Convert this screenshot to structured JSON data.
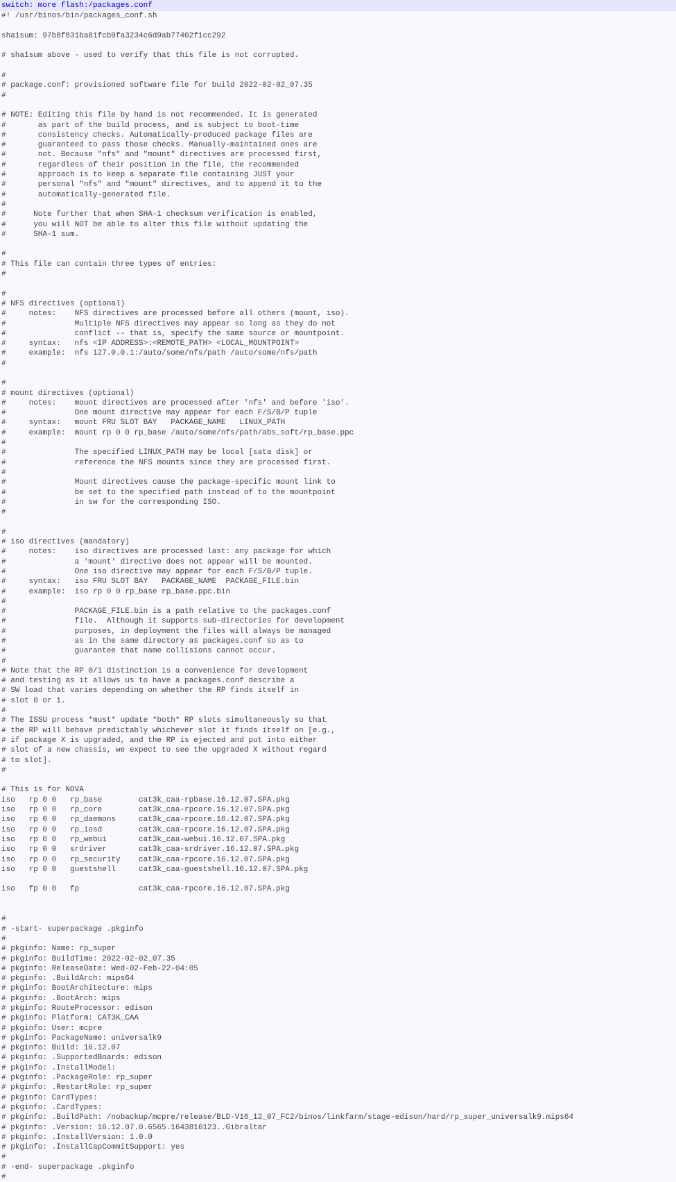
{
  "command": "switch: more flash:/packages.conf",
  "lines": [
    "#! /usr/binos/bin/packages_conf.sh",
    "",
    "sha1sum: 97b8f831ba81fcb9fa3234c6d9ab77402f1cc292",
    "",
    "# sha1sum above - used to verify that this file is not corrupted.",
    "",
    "#",
    "# package.conf: provisioned software file for build 2022-02-02_07.35",
    "#",
    "",
    "# NOTE: Editing this file by hand is not recommended. It is generated",
    "#       as part of the build process, and is subject to boot-time",
    "#       consistency checks. Automatically-produced package files are",
    "#       guaranteed to pass those checks. Manually-maintained ones are",
    "#       not. Because \"nfs\" and \"mount\" directives are processed first,",
    "#       regardless of their position in the file, the recommended",
    "#       approach is to keep a separate file containing JUST your",
    "#       personal \"nfs\" and \"mount\" directives, and to append it to the",
    "#       automatically-generated file.",
    "#",
    "#      Note further that when SHA-1 checksum verification is enabled,",
    "#      you will NOT be able to alter this file without updating the",
    "#      SHA-1 sum.",
    "",
    "#",
    "# This file can contain three types of entries:",
    "#",
    "",
    "#",
    "# NFS directives (optional)",
    "#     notes:    NFS directives are processed before all others (mount, iso).",
    "#               Multiple NFS directives may appear so long as they do not",
    "#               conflict -- that is, specify the same source or mountpoint.",
    "#     syntax:   nfs <IP ADDRESS>:<REMOTE_PATH> <LOCAL_MOUNTPOINT>",
    "#     example:  nfs 127.0.0.1:/auto/some/nfs/path /auto/some/nfs/path",
    "#",
    "",
    "#",
    "# mount directives (optional)",
    "#     notes:    mount directives are processed after 'nfs' and before 'iso'.",
    "#               One mount directive may appear for each F/S/B/P tuple",
    "#     syntax:   mount FRU SLOT BAY   PACKAGE_NAME   LINUX_PATH",
    "#     example:  mount rp 0 0 rp_base /auto/some/nfs/path/abs_soft/rp_base.ppc",
    "#",
    "#               The specified LINUX_PATH may be local [sata disk] or",
    "#               reference the NFS mounts since they are processed first.",
    "#",
    "#               Mount directives cause the package-specific mount link to",
    "#               be set to the specified path instead of to the mountpoint",
    "#               in sw for the corresponding ISO.",
    "#",
    "",
    "#",
    "# iso directives (mandatory)",
    "#     notes:    iso directives are processed last: any package for which",
    "#               a 'mount' directive does not appear will be mounted.",
    "#               One iso directive may appear for each F/S/B/P tuple.",
    "#     syntax:   iso FRU SLOT BAY   PACKAGE_NAME  PACKAGE_FILE.bin",
    "#     example:  iso rp 0 0 rp_base rp_base.ppc.bin",
    "#",
    "#               PACKAGE_FILE.bin is a path relative to the packages.conf",
    "#               file.  Although it supports sub-directories for development",
    "#               purposes, in deployment the files will always be managed",
    "#               as in the same directory as packages.conf so as to",
    "#               guarantee that name collisions cannot occur.",
    "#",
    "# Note that the RP 0/1 distinction is a convenience for development",
    "# and testing as it allows us to have a packages.conf describe a",
    "# SW load that varies depending on whether the RP finds itself in",
    "# slot 0 or 1.",
    "#",
    "# The ISSU process *must* update *both* RP slots simultaneously so that",
    "# the RP will behave predictably whichever slot it finds itself on [e.g.,",
    "# if package X is upgraded, and the RP is ejected and put into either",
    "# slot of a new chassis, we expect to see the upgraded X without regard",
    "# to slot].",
    "#",
    "",
    "# This is for NOVA",
    "iso   rp 0 0   rp_base        cat3k_caa-rpbase.16.12.07.SPA.pkg",
    "iso   rp 0 0   rp_core        cat3k_caa-rpcore.16.12.07.SPA.pkg",
    "iso   rp 0 0   rp_daemons     cat3k_caa-rpcore.16.12.07.SPA.pkg",
    "iso   rp 0 0   rp_iosd        cat3k_caa-rpcore.16.12.07.SPA.pkg",
    "iso   rp 0 0   rp_webui       cat3k_caa-webui.16.12.07.SPA.pkg",
    "iso   rp 0 0   srdriver       cat3k_caa-srdriver.16.12.07.SPA.pkg",
    "iso   rp 0 0   rp_security    cat3k_caa-rpcore.16.12.07.SPA.pkg",
    "iso   rp 0 0   guestshell     cat3k_caa-guestshell.16.12.07.SPA.pkg",
    "",
    "iso   fp 0 0   fp             cat3k_caa-rpcore.16.12.07.SPA.pkg",
    "",
    "",
    "#",
    "# -start- superpackage .pkginfo",
    "#",
    "# pkginfo: Name: rp_super",
    "# pkginfo: BuildTime: 2022-02-02_07.35",
    "# pkginfo: ReleaseDate: Wed-02-Feb-22-04:05",
    "# pkginfo: .BuildArch: mips64",
    "# pkginfo: BootArchitecture: mips",
    "# pkginfo: .BootArch: mips",
    "# pkginfo: RouteProcessor: edison",
    "# pkginfo: Platform: CAT3K_CAA",
    "# pkginfo: User: mcpre",
    "# pkginfo: PackageName: universalk9",
    "# pkginfo: Build: 16.12.07",
    "# pkginfo: .SupportedBoards: edison",
    "# pkginfo: .InstallModel:",
    "# pkginfo: .PackageRole: rp_super",
    "# pkginfo: .RestartRole: rp_super",
    "# pkginfo: CardTypes:",
    "# pkginfo: .CardTypes:",
    "# pkginfo: .BuildPath: /nobackup/mcpre/release/BLD-V16_12_07_FC2/binos/linkfarm/stage-edison/hard/rp_super_universalk9.mips64",
    "# pkginfo: .Version: 16.12.07.0.6565.1643816123..Gibraltar",
    "# pkginfo: .InstallVersion: 1.0.0",
    "# pkginfo: .InstallCapCommitSupport: yes",
    "#",
    "# -end- superpackage .pkginfo",
    "#"
  ]
}
